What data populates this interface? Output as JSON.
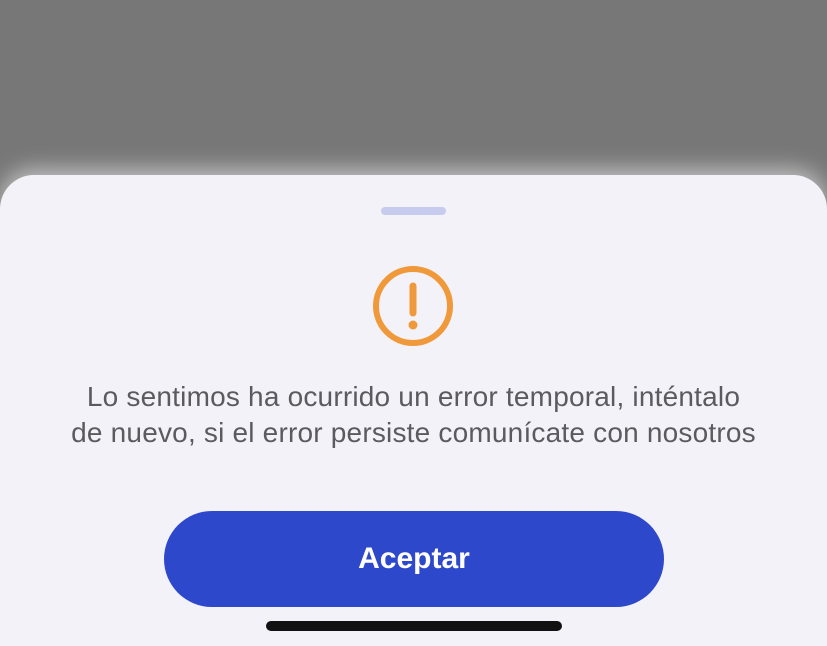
{
  "dialog": {
    "message_line_1": "Lo sentimos ha ocurrido un error temporal, inténtalo",
    "message_line_2": "de nuevo, si el error persiste comunícate con nosotros",
    "accept_label": "Aceptar",
    "icon": "alert-circle-icon"
  },
  "colors": {
    "overlay": "#777777",
    "sheet_background": "#f3f2f8",
    "grabber": "#c7ccee",
    "alert_orange": "#f0993a",
    "message_text": "#5b5b5f",
    "button_blue": "#2e48cc",
    "button_text": "#ffffff",
    "home_indicator": "#111111"
  }
}
